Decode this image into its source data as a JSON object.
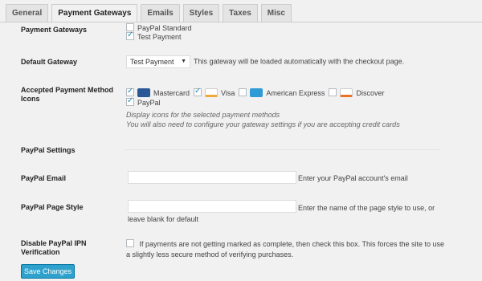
{
  "tabs": [
    {
      "label": "General"
    },
    {
      "label": "Payment Gateways"
    },
    {
      "label": "Emails"
    },
    {
      "label": "Styles"
    },
    {
      "label": "Taxes"
    },
    {
      "label": "Misc"
    }
  ],
  "payment_gateways": {
    "label": "Payment Gateways",
    "options": [
      {
        "label": "PayPal Standard",
        "checked": false
      },
      {
        "label": "Test Payment",
        "checked": true
      }
    ]
  },
  "default_gateway": {
    "label": "Default Gateway",
    "selected": "Test Payment",
    "description": "This gateway will be loaded automatically with the checkout page."
  },
  "accepted_icons": {
    "label_line1": "Accepted Payment Method",
    "label_line2": "Icons",
    "cards": [
      {
        "label": "Mastercard",
        "checked": true,
        "color": "#2b5797"
      },
      {
        "label": "Visa",
        "checked": true,
        "color": "#f0a93b"
      },
      {
        "label": "American Express",
        "checked": false,
        "color": "#2e9ad6"
      },
      {
        "label": "Discover",
        "checked": false,
        "color": "#e8742b"
      },
      {
        "label": "PayPal",
        "checked": true
      }
    ],
    "help1": "Display icons for the selected payment methods",
    "help2": "You will also need to configure your gateway settings if you are accepting credit cards"
  },
  "paypal_settings": {
    "label": "PayPal Settings"
  },
  "paypal_email": {
    "label": "PayPal Email",
    "value": "",
    "description": "Enter your PayPal account's email"
  },
  "paypal_page_style": {
    "label": "PayPal Page Style",
    "value": "",
    "description_line1": "Enter the name of the page style to use, or",
    "description_line2": "leave blank for default"
  },
  "disable_ipn": {
    "label_line1": "Disable PayPal IPN",
    "label_line2": "Verification",
    "checked": false,
    "description_line1": "If payments are not getting marked as complete, then check this box. This forces the site to use",
    "description_line2": "a slightly less secure method of verifying purchases."
  },
  "save_button": {
    "label": "Save Changes"
  },
  "colors": {
    "accent": "#2ea2cc",
    "tab_bg": "#e4e4e4",
    "page_bg": "#f1f1f1"
  }
}
